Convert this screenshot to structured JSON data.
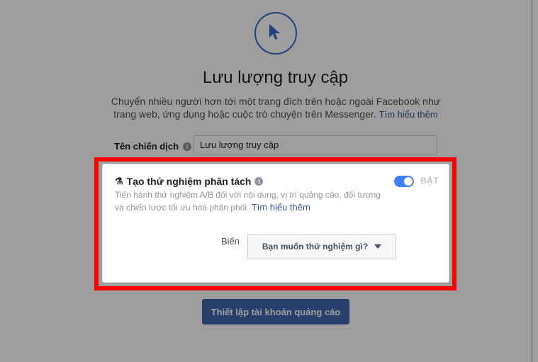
{
  "header": {
    "icon": "cursor-arrow-icon",
    "title": "Lưu lượng truy cập",
    "subtitle": "Chuyển nhiều người hơn tới một trang đích trên hoặc ngoài Facebook như trang web, ứng dụng hoặc cuộc trò chuyện trên Messenger.",
    "learn_more": "Tìm hiểu thêm"
  },
  "campaign_name": {
    "label": "Tên chiến dịch",
    "value": "Lưu lượng truy cập"
  },
  "split_test": {
    "title": "Tạo thử nghiệm phân tách",
    "description": "Tiến hành thử nghiệm A/B đối với nội dung, vị trí quảng cáo, đối tượng và chiến lược tối ưu hóa phân phối.",
    "learn_more": "Tìm hiểu thêm",
    "toggle_label": "BẬT",
    "toggle_on": true,
    "variable_label": "Biến",
    "variable_select": "Bạn muốn thử nghiệm gì?"
  },
  "cta": {
    "label": "Thiết lập tài khoản quảng cáo"
  },
  "colors": {
    "accent": "#4267b2",
    "toggle": "#4080ff",
    "highlight": "#ff0000"
  }
}
